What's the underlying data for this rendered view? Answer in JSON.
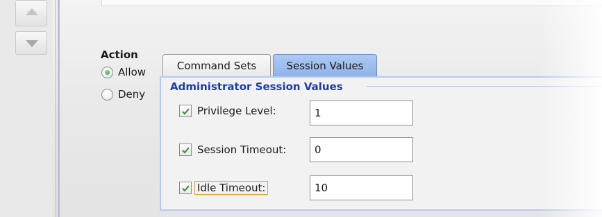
{
  "action": {
    "title": "Action",
    "options": [
      {
        "label": "Allow",
        "selected": true
      },
      {
        "label": "Deny",
        "selected": false
      }
    ]
  },
  "tabs": [
    {
      "label": "Command Sets",
      "active": false
    },
    {
      "label": "Session Values",
      "active": true
    }
  ],
  "panel": {
    "title": "Administrator Session Values",
    "fields": [
      {
        "label": "Privilege Level:",
        "checked": true,
        "value": "1"
      },
      {
        "label": "Session Timeout:",
        "checked": true,
        "value": "0"
      },
      {
        "label": "Idle Timeout:",
        "checked": true,
        "value": "10"
      }
    ]
  },
  "icons": {
    "move_up": "triangle-up-icon",
    "move_down": "triangle-down-icon",
    "checkbox": "checkmark-icon"
  },
  "colors": {
    "panel_title": "#1b3fa8",
    "active_tab": "#9dbdf0",
    "radio_selected": "#2d9a2d",
    "focus_outline": "#e4a23a"
  }
}
